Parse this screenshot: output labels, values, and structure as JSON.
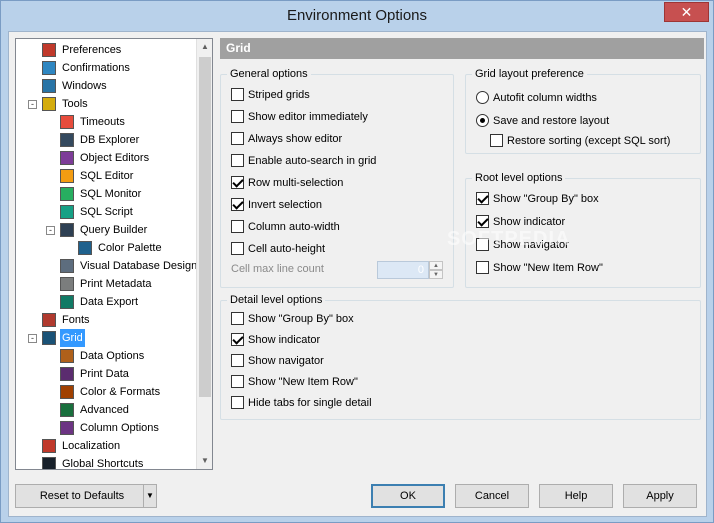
{
  "window": {
    "title": "Environment Options",
    "close_glyph": "✕"
  },
  "tree": {
    "items": [
      {
        "label": "Preferences",
        "icon": "preferences-icon",
        "level": 1
      },
      {
        "label": "Confirmations",
        "icon": "confirmations-icon",
        "level": 1
      },
      {
        "label": "Windows",
        "icon": "windows-icon",
        "level": 1
      },
      {
        "label": "Tools",
        "icon": "tools-icon",
        "level": 1,
        "expander": "-"
      },
      {
        "label": "Timeouts",
        "icon": "timeouts-icon",
        "level": 2
      },
      {
        "label": "DB Explorer",
        "icon": "db-explorer-icon",
        "level": 2
      },
      {
        "label": "Object Editors",
        "icon": "object-editors-icon",
        "level": 2
      },
      {
        "label": "SQL Editor",
        "icon": "sql-editor-icon",
        "level": 2
      },
      {
        "label": "SQL Monitor",
        "icon": "sql-monitor-icon",
        "level": 2
      },
      {
        "label": "SQL Script",
        "icon": "sql-script-icon",
        "level": 2
      },
      {
        "label": "Query Builder",
        "icon": "query-builder-icon",
        "level": 2,
        "expander": "-"
      },
      {
        "label": "Color Palette",
        "icon": "color-palette-icon",
        "level": 3
      },
      {
        "label": "Visual Database Designe",
        "icon": "visual-database-designer-icon",
        "level": 2
      },
      {
        "label": "Print Metadata",
        "icon": "print-metadata-icon",
        "level": 2
      },
      {
        "label": "Data Export",
        "icon": "data-export-icon",
        "level": 2
      },
      {
        "label": "Fonts",
        "icon": "fonts-icon",
        "level": 1
      },
      {
        "label": "Grid",
        "icon": "grid-icon",
        "level": 1,
        "expander": "-",
        "selected": true
      },
      {
        "label": "Data Options",
        "icon": "data-options-icon",
        "level": 2
      },
      {
        "label": "Print Data",
        "icon": "print-data-icon",
        "level": 2
      },
      {
        "label": "Color & Formats",
        "icon": "color-formats-icon",
        "level": 2
      },
      {
        "label": "Advanced",
        "icon": "advanced-icon",
        "level": 2
      },
      {
        "label": "Column Options",
        "icon": "column-options-icon",
        "level": 2
      },
      {
        "label": "Localization",
        "icon": "localization-icon",
        "level": 1
      },
      {
        "label": "Global Shortcuts",
        "icon": "global-shortcuts-icon",
        "level": 1
      }
    ]
  },
  "panel": {
    "header": "Grid",
    "general": {
      "title": "General options",
      "options": [
        {
          "label": "Striped grids",
          "checked": false
        },
        {
          "label": "Show editor immediately",
          "checked": false
        },
        {
          "label": "Always show editor",
          "checked": false
        },
        {
          "label": "Enable auto-search in grid",
          "checked": false
        },
        {
          "label": "Row multi-selection",
          "checked": true
        },
        {
          "label": "Invert selection",
          "checked": true
        },
        {
          "label": "Column auto-width",
          "checked": false
        },
        {
          "label": "Cell auto-height",
          "checked": false
        }
      ],
      "cell_max_label": "Cell max line count",
      "cell_max_value": "0"
    },
    "layout": {
      "title": "Grid layout preference",
      "autofit": "Autofit column widths",
      "save_restore": "Save and restore layout",
      "restore_sorting": "Restore sorting (except SQL sort)"
    },
    "root": {
      "title": "Root level options",
      "options": [
        {
          "label": "Show \"Group By\" box",
          "checked": true
        },
        {
          "label": "Show indicator",
          "checked": true
        },
        {
          "label": "Show navigator",
          "checked": false
        },
        {
          "label": "Show \"New Item Row\"",
          "checked": false
        }
      ]
    },
    "detail": {
      "title": "Detail level options",
      "options": [
        {
          "label": "Show \"Group By\" box",
          "checked": false
        },
        {
          "label": "Show indicator",
          "checked": true
        },
        {
          "label": "Show navigator",
          "checked": false
        },
        {
          "label": "Show \"New Item Row\"",
          "checked": false
        },
        {
          "label": "Hide tabs for single detail",
          "checked": false
        }
      ]
    }
  },
  "buttons": {
    "reset": "Reset to Defaults",
    "ok": "OK",
    "cancel": "Cancel",
    "help": "Help",
    "apply": "Apply"
  },
  "watermark": "SOFTPEDIA"
}
